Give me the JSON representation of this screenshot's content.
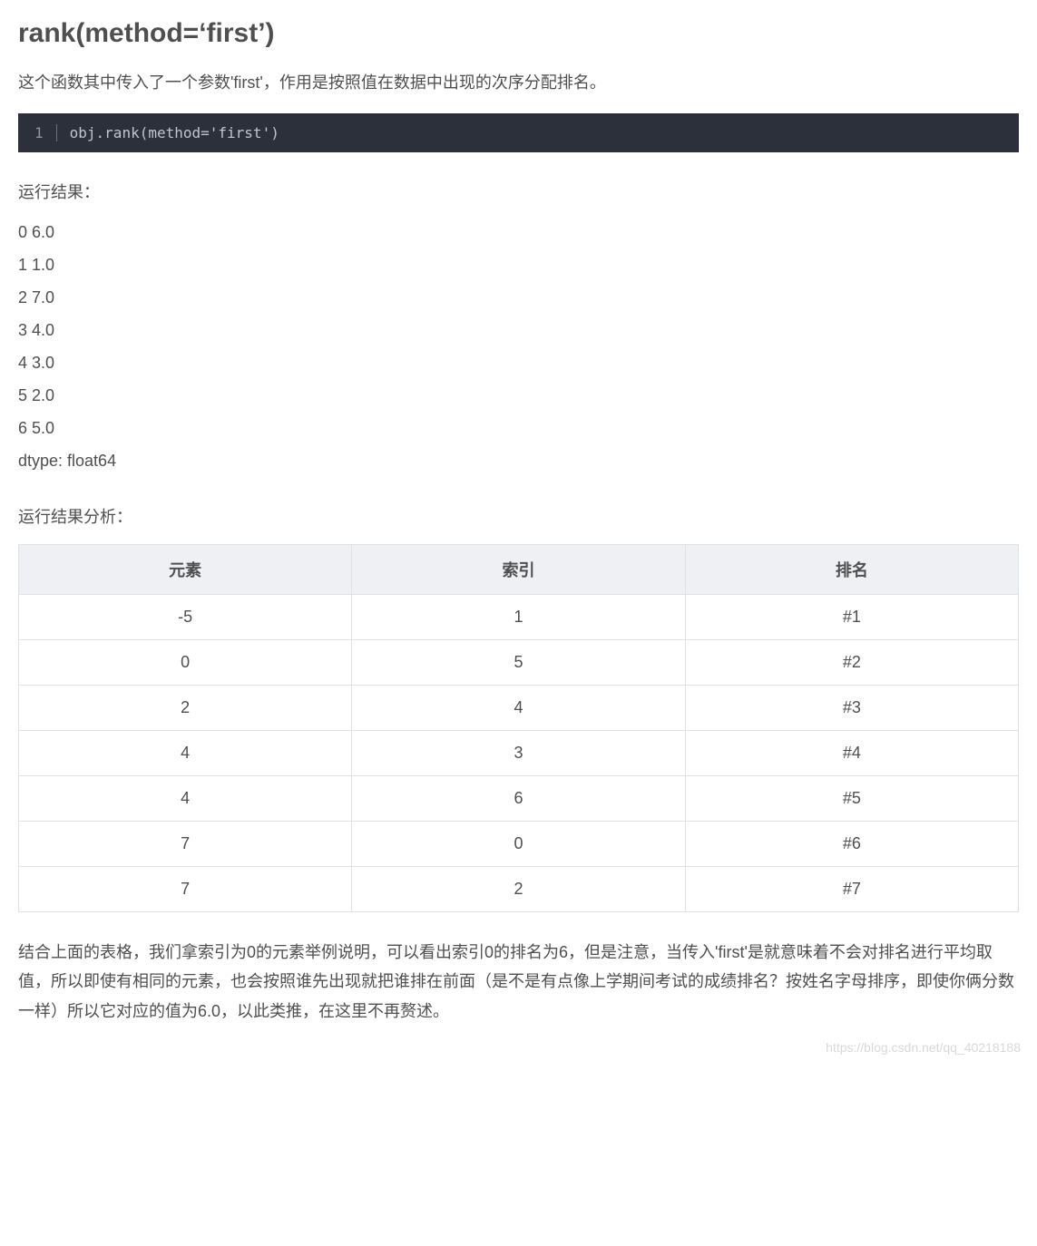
{
  "heading": "rank(method=‘first’)",
  "intro": "这个函数其中传入了一个参数'first'，作用是按照值在数据中出现的次序分配排名。",
  "code": {
    "line_number": "1",
    "content": "obj.rank(method='first')"
  },
  "result_header": "运行结果：",
  "result_lines": [
    "0 6.0",
    "1 1.0",
    "2 7.0",
    "3 4.0",
    "4 3.0",
    "5 2.0",
    "6 5.0",
    "dtype: float64"
  ],
  "analysis_header": "运行结果分析：",
  "table": {
    "headers": [
      "元素",
      "索引",
      "排名"
    ],
    "rows": [
      [
        "-5",
        "1",
        "#1"
      ],
      [
        "0",
        "5",
        "#2"
      ],
      [
        "2",
        "4",
        "#3"
      ],
      [
        "4",
        "3",
        "#4"
      ],
      [
        "4",
        "6",
        "#5"
      ],
      [
        "7",
        "0",
        "#6"
      ],
      [
        "7",
        "2",
        "#7"
      ]
    ]
  },
  "conclusion": "结合上面的表格，我们拿索引为0的元素举例说明，可以看出索引0的排名为6，但是注意，当传入'first'是就意味着不会对排名进行平均取值，所以即使有相同的元素，也会按照谁先出现就把谁排在前面（是不是有点像上学期间考试的成绩排名？按姓名字母排序，即使你俩分数一样）所以它对应的值为6.0，以此类推，在这里不再赘述。",
  "watermark": "https://blog.csdn.net/qq_40218188"
}
